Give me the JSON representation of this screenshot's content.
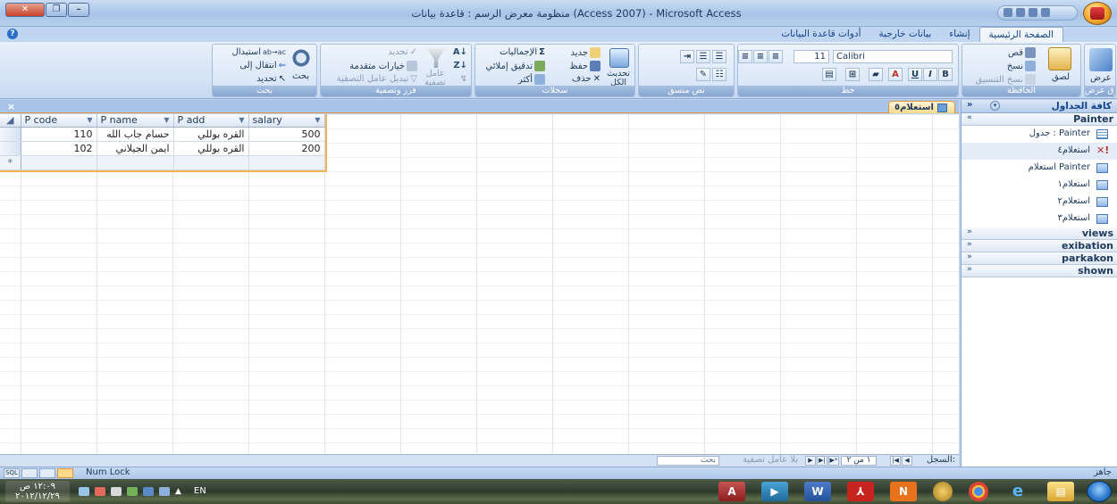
{
  "window": {
    "title": "منظومة معرض الرسم : قاعدة بيانات (Access 2007) - Microsoft Access"
  },
  "ribbon_tabs": [
    "الصفحة الرئيسية",
    "إنشاء",
    "بيانات خارجية",
    "أدوات قاعدة البيانات"
  ],
  "ribbon": {
    "views_group": {
      "caption": "طرق عرض",
      "view_label": "عرض"
    },
    "clipboard_group": {
      "caption": "الحافظة",
      "paste_label": "لصق",
      "cut_label": "قص",
      "copy_label": "نسخ",
      "format_painter_label": "نسخ التنسيق"
    },
    "font_group": {
      "caption": "خط",
      "font_name": "Calibri",
      "font_size": "11",
      "bold": "B",
      "italic": "I",
      "underline": "U",
      "font_color": "A"
    },
    "rich_text_group": {
      "caption": "نص منسق"
    },
    "records_group": {
      "caption": "سجلات",
      "refresh_label": "تحديث الكل",
      "new_label": "جديد",
      "save_label": "حفظ",
      "delete_label": "حذف",
      "totals_label": "الإجماليات",
      "spelling_label": "تدقيق إملائي",
      "more_label": "أكثر"
    },
    "sort_filter_group": {
      "caption": "فرز وتصفية",
      "filter_label": "عامل تصفية",
      "selection_label": "تحديد",
      "advanced_label": "خيارات متقدمة",
      "toggle_filter_label": "تبديل عامل التصفية"
    },
    "find_group": {
      "caption": "بحث",
      "find_label": "بحث",
      "replace_label": "استبدال",
      "goto_label": "انتقال إلى",
      "select_label": "تحديد"
    }
  },
  "document": {
    "close_symbol": "×",
    "tab_label": "استعلام٥",
    "columns": [
      "P code",
      "P name",
      "P add",
      "salary"
    ],
    "rows": [
      [
        "110",
        "حسام جاب الله",
        "القره بوللي",
        "500"
      ],
      [
        "102",
        "ايمن الجيلاني",
        "القره بوللي",
        "200"
      ]
    ],
    "new_row_marker": "*",
    "navbar": {
      "record_label": "السجل:",
      "record_position": "١ من ٢",
      "no_filter_label": "بلا عامل تصفية",
      "search_label": "بحث"
    }
  },
  "navpane": {
    "title": "كافة الجداول",
    "collapse_symbol": "»",
    "groups": [
      {
        "name": "Painter",
        "expanded": true,
        "chevron": "«",
        "items": [
          {
            "label": "Painter : جدول",
            "icon": "table-icon"
          },
          {
            "label": "استعلام٤",
            "icon": "action-query-icon",
            "selected": true
          },
          {
            "label": "Painter استعلام",
            "icon": "query-icon"
          },
          {
            "label": "استعلام١",
            "icon": "query-icon"
          },
          {
            "label": "استعلام٢",
            "icon": "query-icon"
          },
          {
            "label": "استعلام٣",
            "icon": "query-icon"
          }
        ]
      },
      {
        "name": "views",
        "expanded": false,
        "chevron": "»"
      },
      {
        "name": "exibation",
        "expanded": false,
        "chevron": "»"
      },
      {
        "name": "parkakon",
        "expanded": false,
        "chevron": "»"
      },
      {
        "name": "shown",
        "expanded": false,
        "chevron": "»"
      }
    ]
  },
  "statusbar": {
    "ready": "جاهز",
    "num_lock": "Num Lock",
    "view_labels": [
      "SQL"
    ]
  },
  "taskbar": {
    "clock_time": "١٢:٠٩ ص",
    "clock_date": "٢٠١٢/١٢/٢٩",
    "language": "EN",
    "apps": [
      "start-orb",
      "explorer",
      "internet-explorer",
      "chrome",
      "quran-app",
      "onenote",
      "acrobat",
      "word",
      "media-player",
      "access"
    ]
  },
  "colors": {
    "selection_outline": "#f2b15a",
    "ribbon_blue": "#c6d9f1",
    "title_text": "#1e395b"
  }
}
